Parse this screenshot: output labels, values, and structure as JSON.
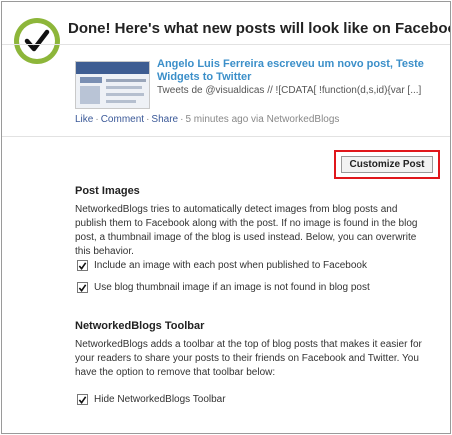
{
  "header": {
    "title": "Done! Here's what new posts will look like on Facebook"
  },
  "preview": {
    "post_title": "Angelo Luis Ferreira escreveu um novo post, Teste Widgets to Twitter",
    "snippet": "Tweets de @visualdicas // ![CDATA[ !function(d,s,id){var [...]",
    "actions": {
      "like": "Like",
      "comment": "Comment",
      "share": "Share",
      "meta": "5 minutes ago via NetworkedBlogs"
    }
  },
  "customize_button": "Customize Post",
  "post_images": {
    "title": "Post Images",
    "description": "NetworkedBlogs tries to automatically detect images from blog posts and publish them to Facebook along with the post. If no image is found in the blog post, a thumbnail image of the blog is used instead. Below, you can overwrite this behavior.",
    "options": [
      {
        "label": "Include an image with each post when published to Facebook",
        "checked": true
      },
      {
        "label": "Use blog thumbnail image if an image is not found in blog post",
        "checked": true
      }
    ]
  },
  "toolbar": {
    "title": "NetworkedBlogs Toolbar",
    "description": "NetworkedBlogs adds a toolbar at the top of blog posts that makes it easier for your readers to share your posts to their friends on Facebook and Twitter. You have the option to remove that toolbar below:",
    "options": [
      {
        "label": "Hide NetworkedBlogs Toolbar",
        "checked": true
      }
    ]
  },
  "icons": {
    "done": "check-circle-icon",
    "checkbox": "checkmark-icon"
  },
  "colors": {
    "badge_green": "#8db63a",
    "link_blue": "#3b8fc9",
    "highlight_red": "#e0161b"
  }
}
